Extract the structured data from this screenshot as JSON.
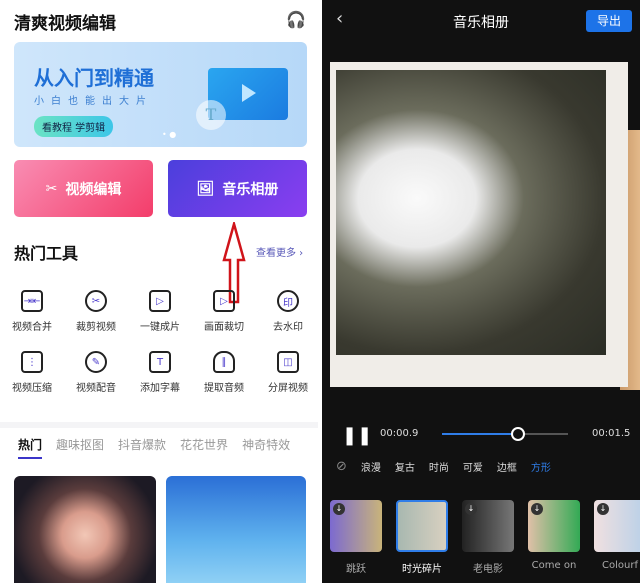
{
  "left": {
    "app_title": "清爽视频编辑",
    "headset_icon": "headset-icon",
    "banner": {
      "title": "从入门到精通",
      "subtitle": "小白也能出大片",
      "button": "看教程 学剪辑",
      "t_glyph": "T",
      "dots": "• ●"
    },
    "cards": [
      {
        "label": "视频编辑",
        "icon": "scissors-icon"
      },
      {
        "label": "音乐相册",
        "icon": "image-icon"
      }
    ],
    "section_title": "热门工具",
    "see_more": "查看更多 ›",
    "tools": [
      {
        "label": "视频合并",
        "glyph": "⇥⇤"
      },
      {
        "label": "裁剪视频",
        "glyph": "✂"
      },
      {
        "label": "一键成片",
        "glyph": "▷"
      },
      {
        "label": "画面裁切",
        "glyph": "▷"
      },
      {
        "label": "去水印",
        "glyph": "印"
      },
      {
        "label": "视频压缩",
        "glyph": "⋮"
      },
      {
        "label": "视频配音",
        "glyph": "✎"
      },
      {
        "label": "添加字幕",
        "glyph": "T"
      },
      {
        "label": "提取音频",
        "glyph": "∥"
      },
      {
        "label": "分屏视频",
        "glyph": "◫"
      }
    ],
    "tabs": [
      "热门",
      "趣味抠图",
      "抖音爆款",
      "花花世界",
      "神奇特效"
    ]
  },
  "right": {
    "title": "音乐相册",
    "export": "导出",
    "back": "‹",
    "current_time": "00:00.9",
    "total_time": "00:01.5",
    "progress_percent": 60,
    "pause": "❚❚",
    "none_icon": "⃠",
    "categories": [
      "浪漫",
      "复古",
      "时尚",
      "可爱",
      "边框",
      "方形"
    ],
    "active_category": "方形",
    "templates": [
      {
        "label": "跳跃",
        "download": true,
        "colors": [
          "#7c6ad0",
          "#c9b47a"
        ]
      },
      {
        "label": "时光碎片",
        "download": false,
        "selected": true,
        "colors": [
          "#a8b8b0",
          "#d8d0c0"
        ]
      },
      {
        "label": "老电影",
        "download": true,
        "colors": [
          "#222",
          "#777"
        ]
      },
      {
        "label": "Come on",
        "download": true,
        "colors": [
          "#e0c0a8",
          "#3a5"
        ]
      },
      {
        "label": "Colourf",
        "download": true,
        "colors": [
          "#f0e0e0",
          "#b8d0e8"
        ]
      }
    ]
  },
  "colors": {
    "accent": "#2f7de8",
    "annotation_arrow": "#d0141a"
  }
}
